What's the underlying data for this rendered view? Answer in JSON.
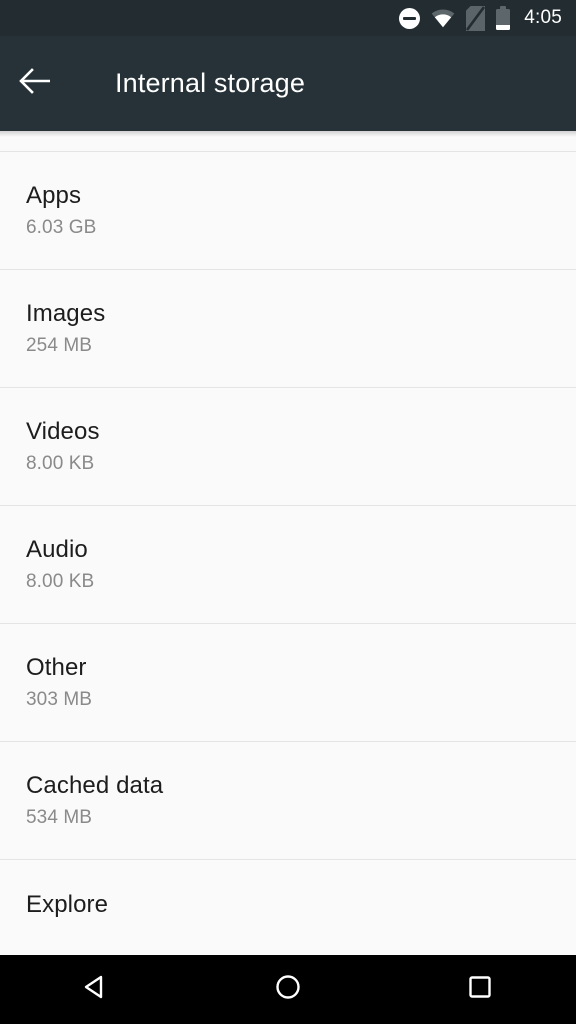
{
  "status_bar": {
    "time": "4:05",
    "icons": [
      {
        "name": "do-not-disturb-icon",
        "label": "Do not disturb"
      },
      {
        "name": "wifi-icon",
        "label": "Wi-Fi connected"
      },
      {
        "name": "no-sim-icon",
        "label": "No SIM card"
      },
      {
        "name": "battery-icon",
        "label": "Battery low"
      }
    ],
    "background_color": "#222c31"
  },
  "toolbar": {
    "title": "Internal storage",
    "back_icon": "arrow-back-icon",
    "background_color": "#263238",
    "text_color": "#ffffff"
  },
  "storage_list": {
    "rows": [
      {
        "title": "Apps",
        "size": "6.03 GB"
      },
      {
        "title": "Images",
        "size": "254 MB"
      },
      {
        "title": "Videos",
        "size": "8.00 KB"
      },
      {
        "title": "Audio",
        "size": "8.00 KB"
      },
      {
        "title": "Other",
        "size": "303 MB"
      },
      {
        "title": "Cached data",
        "size": "534 MB"
      },
      {
        "title": "Explore",
        "size": ""
      }
    ],
    "background_color": "#fafafa",
    "divider_color": "#e4e4e4",
    "title_color": "#1d1d1d",
    "subtitle_color": "#8a8a8a"
  },
  "nav_bar": {
    "buttons": [
      {
        "name": "nav-back-button",
        "icon": "triangle-back-icon"
      },
      {
        "name": "nav-home-button",
        "icon": "circle-home-icon"
      },
      {
        "name": "nav-recents-button",
        "icon": "square-recents-icon"
      }
    ],
    "background_color": "#000000"
  }
}
